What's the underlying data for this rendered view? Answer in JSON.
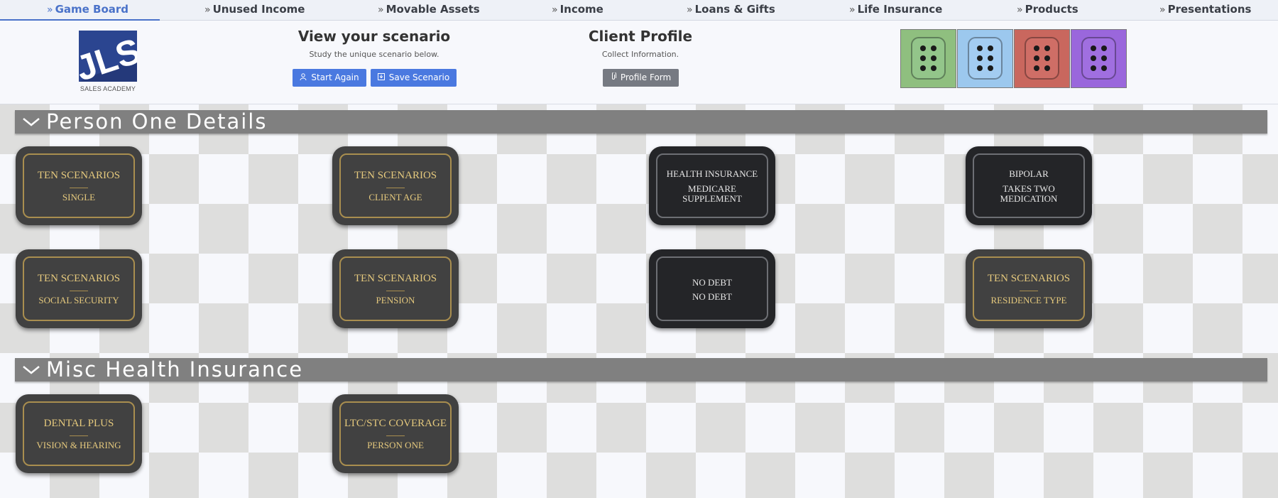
{
  "nav": {
    "items": [
      {
        "label": "Game Board",
        "active": true
      },
      {
        "label": "Unused Income"
      },
      {
        "label": "Movable Assets"
      },
      {
        "label": "Income"
      },
      {
        "label": "Loans & Gifts"
      },
      {
        "label": "Life Insurance"
      },
      {
        "label": "Products"
      },
      {
        "label": "Presentations"
      }
    ]
  },
  "logo": {
    "text": "JLS",
    "subtitle": "SALES ACADEMY"
  },
  "scenario": {
    "title": "View your scenario",
    "subtitle": "Study the unique scenario below.",
    "start_again_label": "Start Again",
    "save_scenario_label": "Save Scenario"
  },
  "client_profile": {
    "title": "Client Profile",
    "subtitle": "Collect Information.",
    "profile_form_label": "Profile Form"
  },
  "dice": [
    {
      "color": "#8fbf7f",
      "face_color": "#93c58a",
      "pips": 6
    },
    {
      "color": "#9cc8ee",
      "face_color": "#a3ccf1",
      "pips": 6
    },
    {
      "color": "#c9675e",
      "face_color": "#cf6e66",
      "pips": 6
    },
    {
      "color": "#9a67dc",
      "face_color": "#a06fe0",
      "pips": 6
    }
  ],
  "sections": [
    {
      "title": "Person One Details",
      "cards": [
        {
          "style": "gold",
          "top": "TEN SCENARIOS",
          "bottom": "SINGLE"
        },
        {
          "style": "gold",
          "top": "TEN SCENARIOS",
          "bottom": "CLIENT AGE"
        },
        {
          "style": "dark",
          "top": "HEALTH INSURANCE",
          "bottom": "MEDICARE SUPPLEMENT"
        },
        {
          "style": "dark",
          "top": "BIPOLAR",
          "bottom": "TAKES TWO MEDICATION"
        },
        {
          "style": "gold",
          "top": "TEN SCENARIOS",
          "bottom": "SOCIAL SECURITY"
        },
        {
          "style": "gold",
          "top": "TEN SCENARIOS",
          "bottom": "PENSION"
        },
        {
          "style": "dark",
          "top": "NO DEBT",
          "bottom": "NO DEBT"
        },
        {
          "style": "gold",
          "top": "TEN SCENARIOS",
          "bottom": "RESIDENCE TYPE"
        }
      ]
    },
    {
      "title": "Misc Health Insurance",
      "cards": [
        {
          "style": "gold",
          "top": "DENTAL PLUS",
          "bottom": "VISION & HEARING"
        },
        {
          "style": "gold",
          "top": "LTC/STC COVERAGE",
          "bottom": "PERSON ONE"
        }
      ]
    }
  ],
  "colors": {
    "accent": "#4a72c9",
    "button_blue": "#4a79e0",
    "button_gray": "#767a82",
    "gold": "#e5c97d"
  }
}
